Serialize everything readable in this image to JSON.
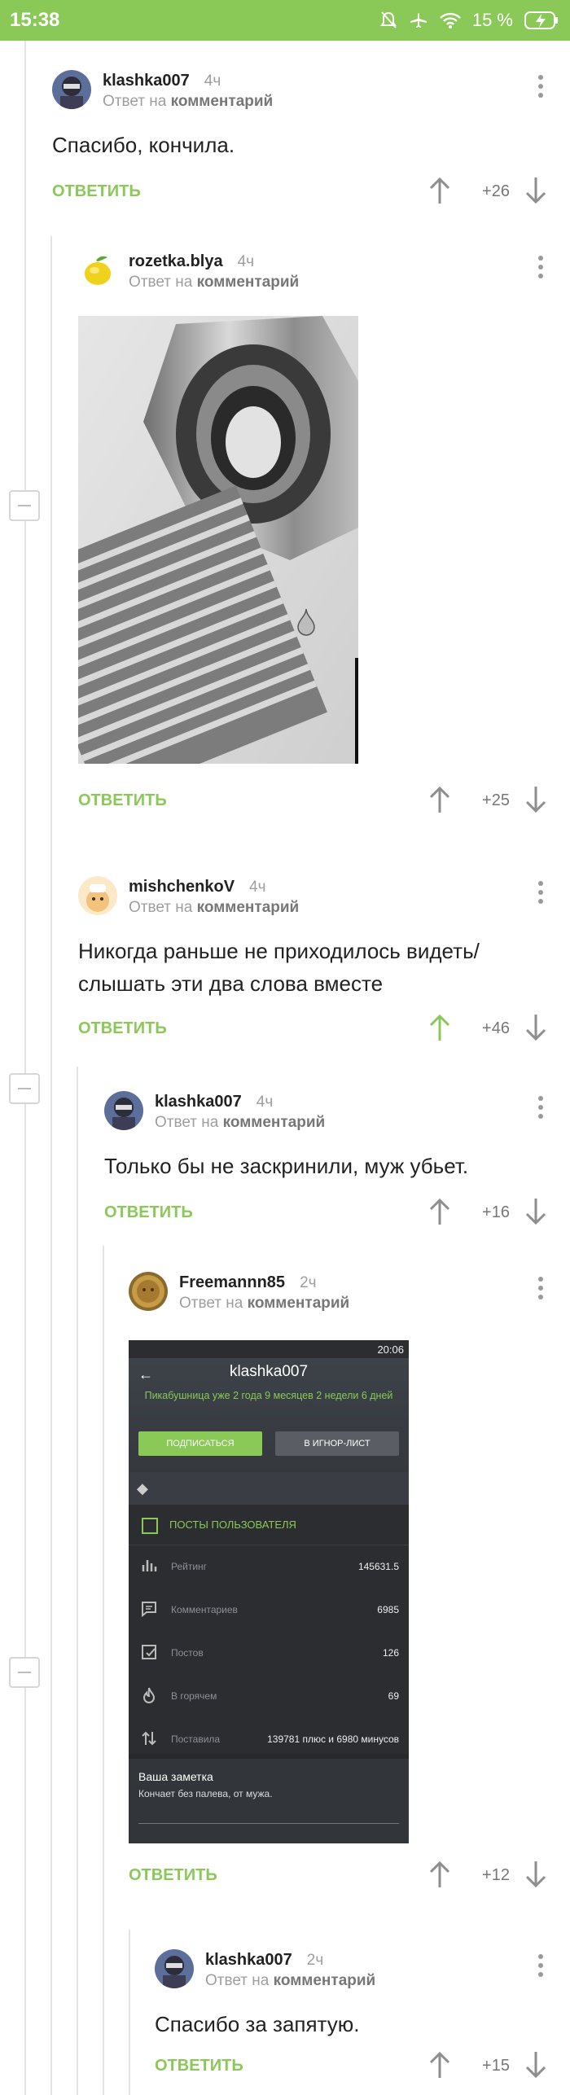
{
  "status": {
    "time": "15:38",
    "battery": "15 %"
  },
  "labels": {
    "reply": "ОТВЕТИТЬ",
    "reply_to": "Ответ на",
    "comment_word": "комментарий"
  },
  "comments": [
    {
      "author": "klashka007",
      "time": "4ч",
      "text": "Спасибо, кончила.",
      "score": "+26"
    },
    {
      "author": "rozetka.blya",
      "time": "4ч",
      "text": "",
      "score": "+25"
    },
    {
      "author": "mishchenkoV",
      "time": "4ч",
      "text": "Никогда раньше не приходилось видеть/ слышать эти два слова вместе",
      "score": "+46"
    },
    {
      "author": "klashka007",
      "time": "4ч",
      "text": "Только бы не заскринили, муж убьет.",
      "score": "+16"
    },
    {
      "author": "Freemannn85",
      "time": "2ч",
      "text": "",
      "score": "+12"
    },
    {
      "author": "klashka007",
      "time": "2ч",
      "text": "Спасибо за запятую.",
      "score": "+15"
    }
  ],
  "screenshot": {
    "time": "20:06",
    "username": "klashka007",
    "since": "Пикабушница уже 2 года 9 месяцев 2 недели 6 дней",
    "subscribe": "ПОДПИСАТЬСЯ",
    "ignore": "В ИГНОР-ЛИСТ",
    "posts": "ПОСТЫ ПОЛЬЗОВАТЕЛЯ",
    "stats": [
      {
        "label": "Рейтинг",
        "value": "145631.5"
      },
      {
        "label": "Комментариев",
        "value": "6985"
      },
      {
        "label": "Постов",
        "value": "126"
      },
      {
        "label": "В горячем",
        "value": "69"
      },
      {
        "label": "Поставила",
        "value": "139781 плюс и 6980 минусов"
      }
    ],
    "note_title": "Ваша заметка",
    "note_text": "Кончает без палева, от мужа."
  },
  "colors": {
    "accent": "#8ac858",
    "muted": "#9e9e9e"
  }
}
